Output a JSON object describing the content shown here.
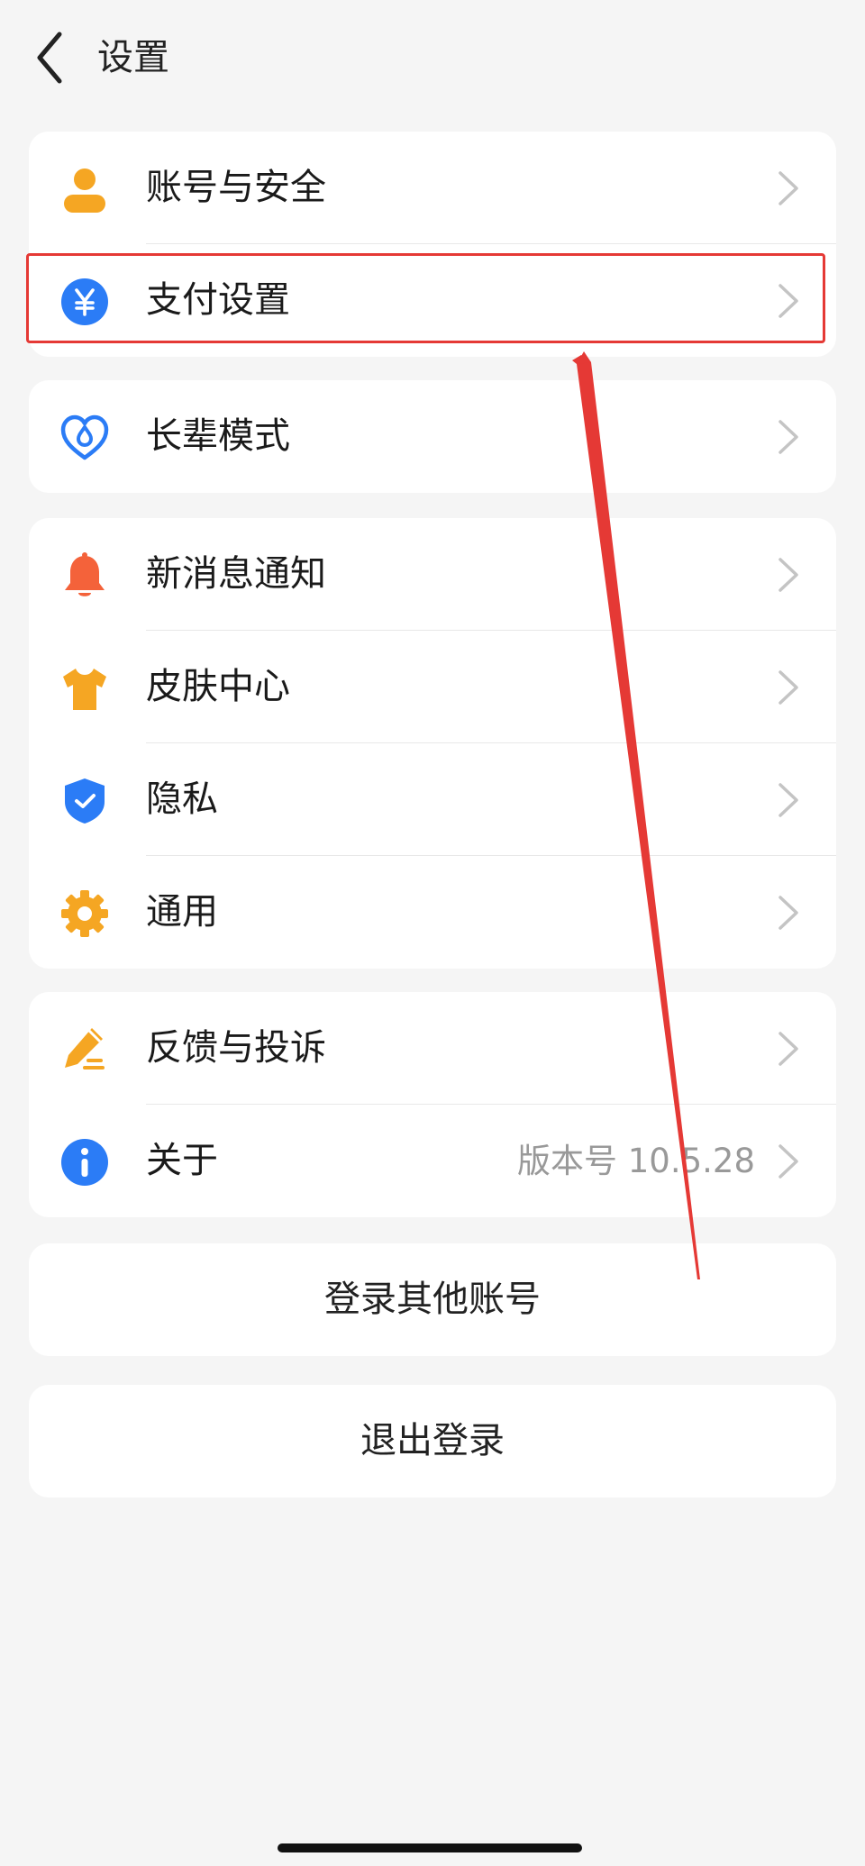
{
  "header": {
    "title": "设置",
    "back_icon": "chevron-left-icon"
  },
  "groups": [
    {
      "items": [
        {
          "label": "账号与安全",
          "icon": "user-icon",
          "icon_color": "#f5a623"
        },
        {
          "label": "支付设置",
          "icon": "yuan-icon",
          "icon_color": "#2b7cf6",
          "highlighted": true
        }
      ]
    },
    {
      "items": [
        {
          "label": "长辈模式",
          "icon": "heart-care-icon",
          "icon_color": "#2b7cf6"
        }
      ]
    },
    {
      "items": [
        {
          "label": "新消息通知",
          "icon": "bell-icon",
          "icon_color": "#f4623a"
        },
        {
          "label": "皮肤中心",
          "icon": "tshirt-icon",
          "icon_color": "#f5a623"
        },
        {
          "label": "隐私",
          "icon": "shield-check-icon",
          "icon_color": "#2b7cf6"
        },
        {
          "label": "通用",
          "icon": "gear-icon",
          "icon_color": "#f5a623"
        }
      ]
    },
    {
      "items": [
        {
          "label": "反馈与投诉",
          "icon": "pen-edit-icon",
          "icon_color": "#f5a623"
        },
        {
          "label": "关于",
          "icon": "info-icon",
          "icon_color": "#2b7cf6",
          "value": "版本号 10.5.28"
        }
      ]
    }
  ],
  "actions": {
    "switch_account": "登录其他账号",
    "logout": "退出登录"
  },
  "colors": {
    "highlight": "#e53935",
    "chevron": "#c4c4c4"
  }
}
